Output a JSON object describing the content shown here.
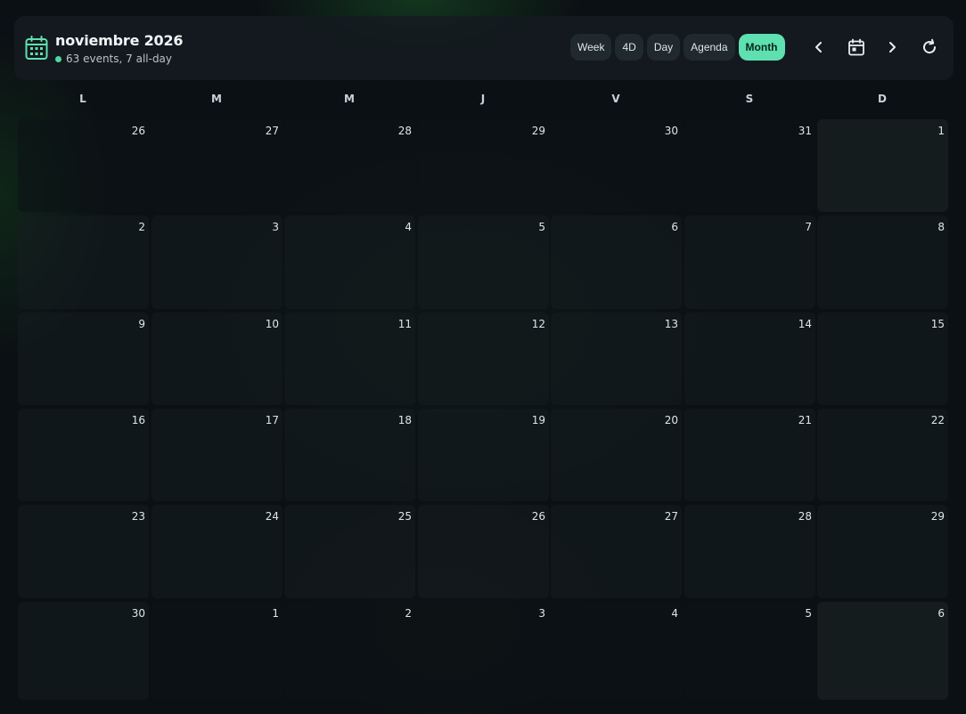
{
  "header": {
    "title": "noviembre 2026",
    "subtitle": "63 events, 7 all-day",
    "accent_color": "#5fe0b0",
    "views": [
      {
        "label": "Week",
        "active": false
      },
      {
        "label": "4D",
        "active": false
      },
      {
        "label": "Day",
        "active": false
      },
      {
        "label": "Agenda",
        "active": false
      },
      {
        "label": "Month",
        "active": true
      }
    ],
    "icons": {
      "calendar": "calendar-icon",
      "prev": "chevron-left-icon",
      "today": "calendar-today-icon",
      "next": "chevron-right-icon",
      "refresh": "refresh-icon"
    }
  },
  "weekdays": [
    "L",
    "M",
    "M",
    "J",
    "V",
    "S",
    "D"
  ],
  "weeks": [
    [
      {
        "day": "26",
        "current": false
      },
      {
        "day": "27",
        "current": false
      },
      {
        "day": "28",
        "current": false
      },
      {
        "day": "29",
        "current": false
      },
      {
        "day": "30",
        "current": false
      },
      {
        "day": "31",
        "current": false
      },
      {
        "day": "1",
        "current": true
      }
    ],
    [
      {
        "day": "2",
        "current": true
      },
      {
        "day": "3",
        "current": true
      },
      {
        "day": "4",
        "current": true
      },
      {
        "day": "5",
        "current": true
      },
      {
        "day": "6",
        "current": true
      },
      {
        "day": "7",
        "current": true
      },
      {
        "day": "8",
        "current": true
      }
    ],
    [
      {
        "day": "9",
        "current": true
      },
      {
        "day": "10",
        "current": true
      },
      {
        "day": "11",
        "current": true
      },
      {
        "day": "12",
        "current": true
      },
      {
        "day": "13",
        "current": true
      },
      {
        "day": "14",
        "current": true
      },
      {
        "day": "15",
        "current": true
      }
    ],
    [
      {
        "day": "16",
        "current": true
      },
      {
        "day": "17",
        "current": true
      },
      {
        "day": "18",
        "current": true
      },
      {
        "day": "19",
        "current": true
      },
      {
        "day": "20",
        "current": true
      },
      {
        "day": "21",
        "current": true
      },
      {
        "day": "22",
        "current": true
      }
    ],
    [
      {
        "day": "23",
        "current": true
      },
      {
        "day": "24",
        "current": true
      },
      {
        "day": "25",
        "current": true
      },
      {
        "day": "26",
        "current": true
      },
      {
        "day": "27",
        "current": true
      },
      {
        "day": "28",
        "current": true
      },
      {
        "day": "29",
        "current": true
      }
    ],
    [
      {
        "day": "30",
        "current": true
      },
      {
        "day": "1",
        "current": false
      },
      {
        "day": "2",
        "current": false
      },
      {
        "day": "3",
        "current": false
      },
      {
        "day": "4",
        "current": false
      },
      {
        "day": "5",
        "current": false
      },
      {
        "day": "6",
        "current": false
      }
    ]
  ]
}
